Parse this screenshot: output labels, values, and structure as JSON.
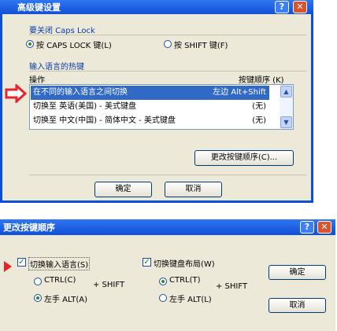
{
  "window1": {
    "title": "高级键设置",
    "caps_group": {
      "title": "要关闭 Caps Lock",
      "option_caps": "按 CAPS LOCK 键(L)",
      "option_shift": "按 SHIFT 键(F)",
      "selected": "caps"
    },
    "hotkey_group": {
      "title": "输入语言的热键",
      "col_action": "操作",
      "col_key": "按键顺序 (K)"
    },
    "hotkeys": [
      {
        "action": "在不同的输入语言之间切换",
        "key": "左边 Alt+Shift",
        "selected": true
      },
      {
        "action": "切换至 英语(美国) - 美式键盘",
        "key": "(无)",
        "selected": false
      },
      {
        "action": "切换至 中文(中国) - 简体中文 - 美式键盘",
        "key": "(无)",
        "selected": false
      }
    ],
    "change_button": "更改按键顺序(C)...",
    "ok_button": "确定",
    "cancel_button": "取消",
    "arrow_color": "#e8242a"
  },
  "window2": {
    "title": "更改按键顺序",
    "lang_group": {
      "checkbox": "切换输入语言(S)",
      "checked": true,
      "opt_ctrl": "CTRL(C)",
      "opt_alt": "左手 ALT(A)",
      "plus_shift": "+ SHIFT",
      "selected": "alt"
    },
    "layout_group": {
      "checkbox": "切换键盘布局(W)",
      "checked": true,
      "opt_ctrl": "CTRL(T)",
      "opt_alt": "左手 ALT(L)",
      "plus_shift": "+ SHIFT",
      "selected": "ctrl"
    },
    "ok_button": "确定",
    "cancel_button": "取消"
  },
  "icons": {
    "help": "?",
    "close": "✕",
    "scroll_up": "▲",
    "scroll_down": "▼",
    "check": "✓"
  }
}
